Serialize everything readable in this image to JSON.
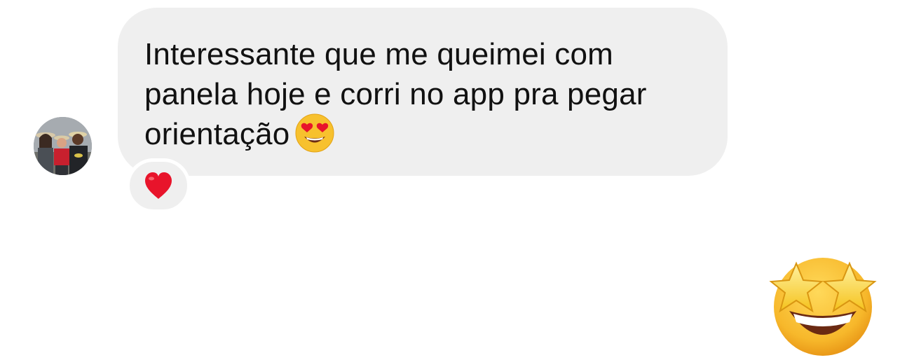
{
  "conversation": {
    "incoming_message": {
      "lines": [
        "Interessante que me queimei com",
        "panela hoje e corri no app pra pegar",
        "orientação"
      ],
      "inline_emoji": "smiling-face-with-heart-eyes"
    },
    "reaction": {
      "emoji": "red-heart"
    },
    "sent_emoji": {
      "emoji": "star-struck"
    }
  },
  "colors": {
    "bubble_background": "#efefef",
    "message_text": "#111111",
    "page_background": "#ffffff",
    "heart": "#e8142b",
    "emoji_yellow": "#f7c12e"
  }
}
